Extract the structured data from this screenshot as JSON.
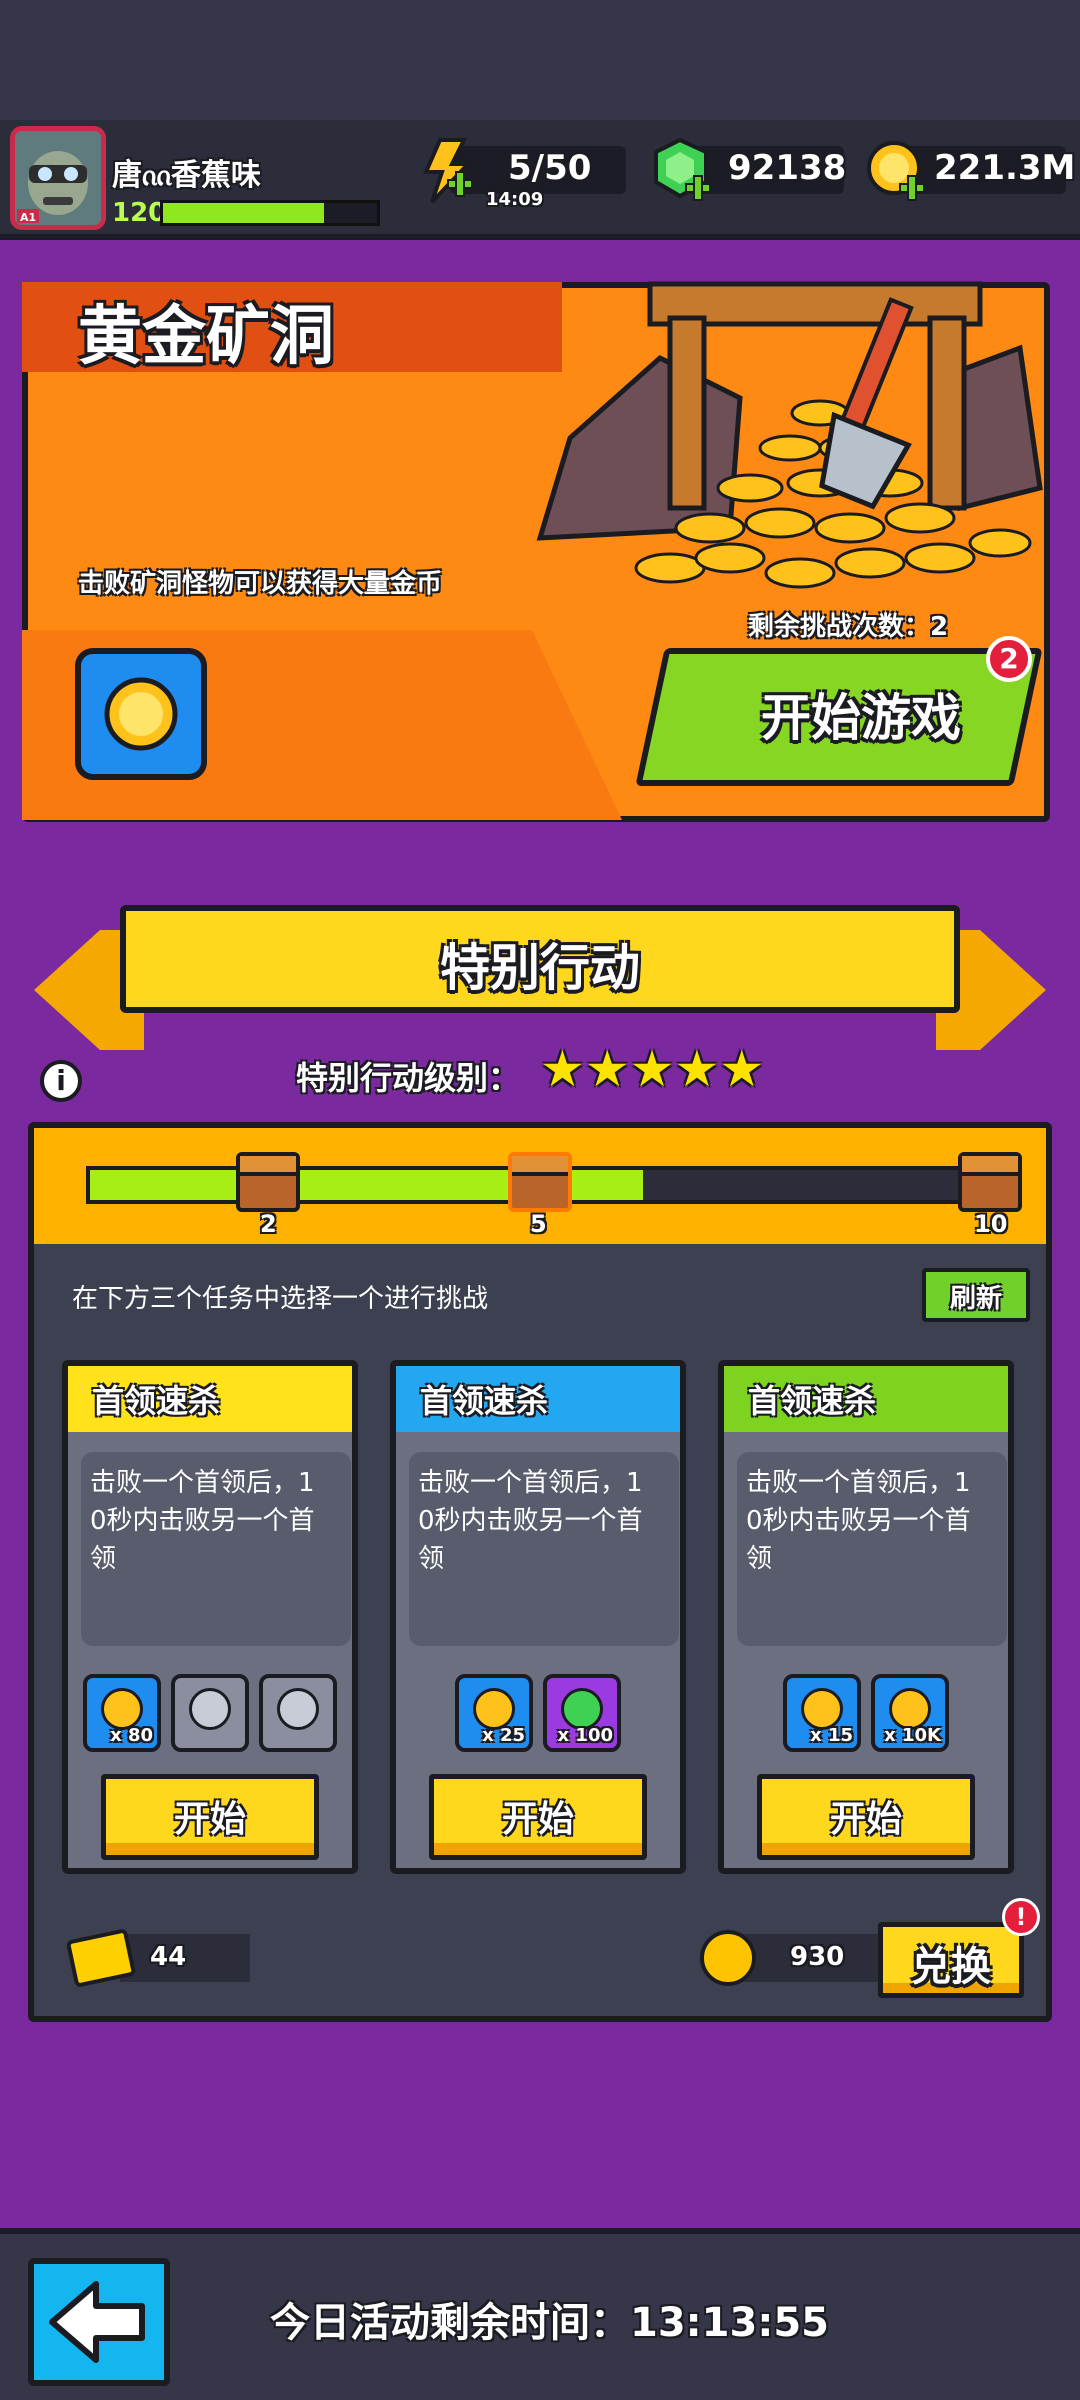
{
  "player": {
    "name": "唐ᦶ香蕉味",
    "level": "120",
    "xp_fraction": 0.75
  },
  "resources": {
    "energy": "5/50",
    "energy_timer": "14:09",
    "gems": "92138",
    "coins": "221.3M"
  },
  "event": {
    "title": "黄金矿洞",
    "description": "击败矿洞怪物可以获得大量金币",
    "remaining": "剩余挑战次数：2",
    "start_label": "开始游戏",
    "badge": "2"
  },
  "special": {
    "banner_title": "特别行动",
    "level_label": "特别行动级别：",
    "stars": 5,
    "info_icon": "i",
    "progress": {
      "value": 6,
      "max": 10,
      "milestones": [
        "2",
        "5",
        "10"
      ]
    },
    "choose_label": "在下方三个任务中选择一个进行挑战",
    "refresh_label": "刷新"
  },
  "missions": [
    {
      "title": "首领速杀",
      "head_color": "#ffe21a",
      "description": "击败一个首领后，1\n0秒内击败另一个首\n领",
      "rewards": [
        {
          "icon": "coin-token-icon",
          "qty": "x 80"
        },
        {
          "icon": "amulet-icon",
          "qty": ""
        },
        {
          "icon": "shield-gear-icon",
          "qty": ""
        }
      ],
      "start_label": "开始"
    },
    {
      "title": "首领速杀",
      "head_color": "#22a7f0",
      "description": "击败一个首领后，1\n0秒内击败另一个首\n领",
      "rewards": [
        {
          "icon": "coin-token-icon",
          "qty": "x 25"
        },
        {
          "icon": "gem-icon",
          "qty": "x 100"
        }
      ],
      "start_label": "开始"
    },
    {
      "title": "首领速杀",
      "head_color": "#7ed321",
      "description": "击败一个首领后，1\n0秒内击败另一个首\n领",
      "rewards": [
        {
          "icon": "coin-token-icon",
          "qty": "x 15"
        },
        {
          "icon": "gold-coin-icon",
          "qty": "x 10K"
        }
      ],
      "start_label": "开始"
    }
  ],
  "currency": {
    "tickets": "44",
    "tokens": "930",
    "exchange_label": "兑换",
    "alert": "!"
  },
  "footer": {
    "time_label": "今日活动剩余时间：13:13:55"
  }
}
